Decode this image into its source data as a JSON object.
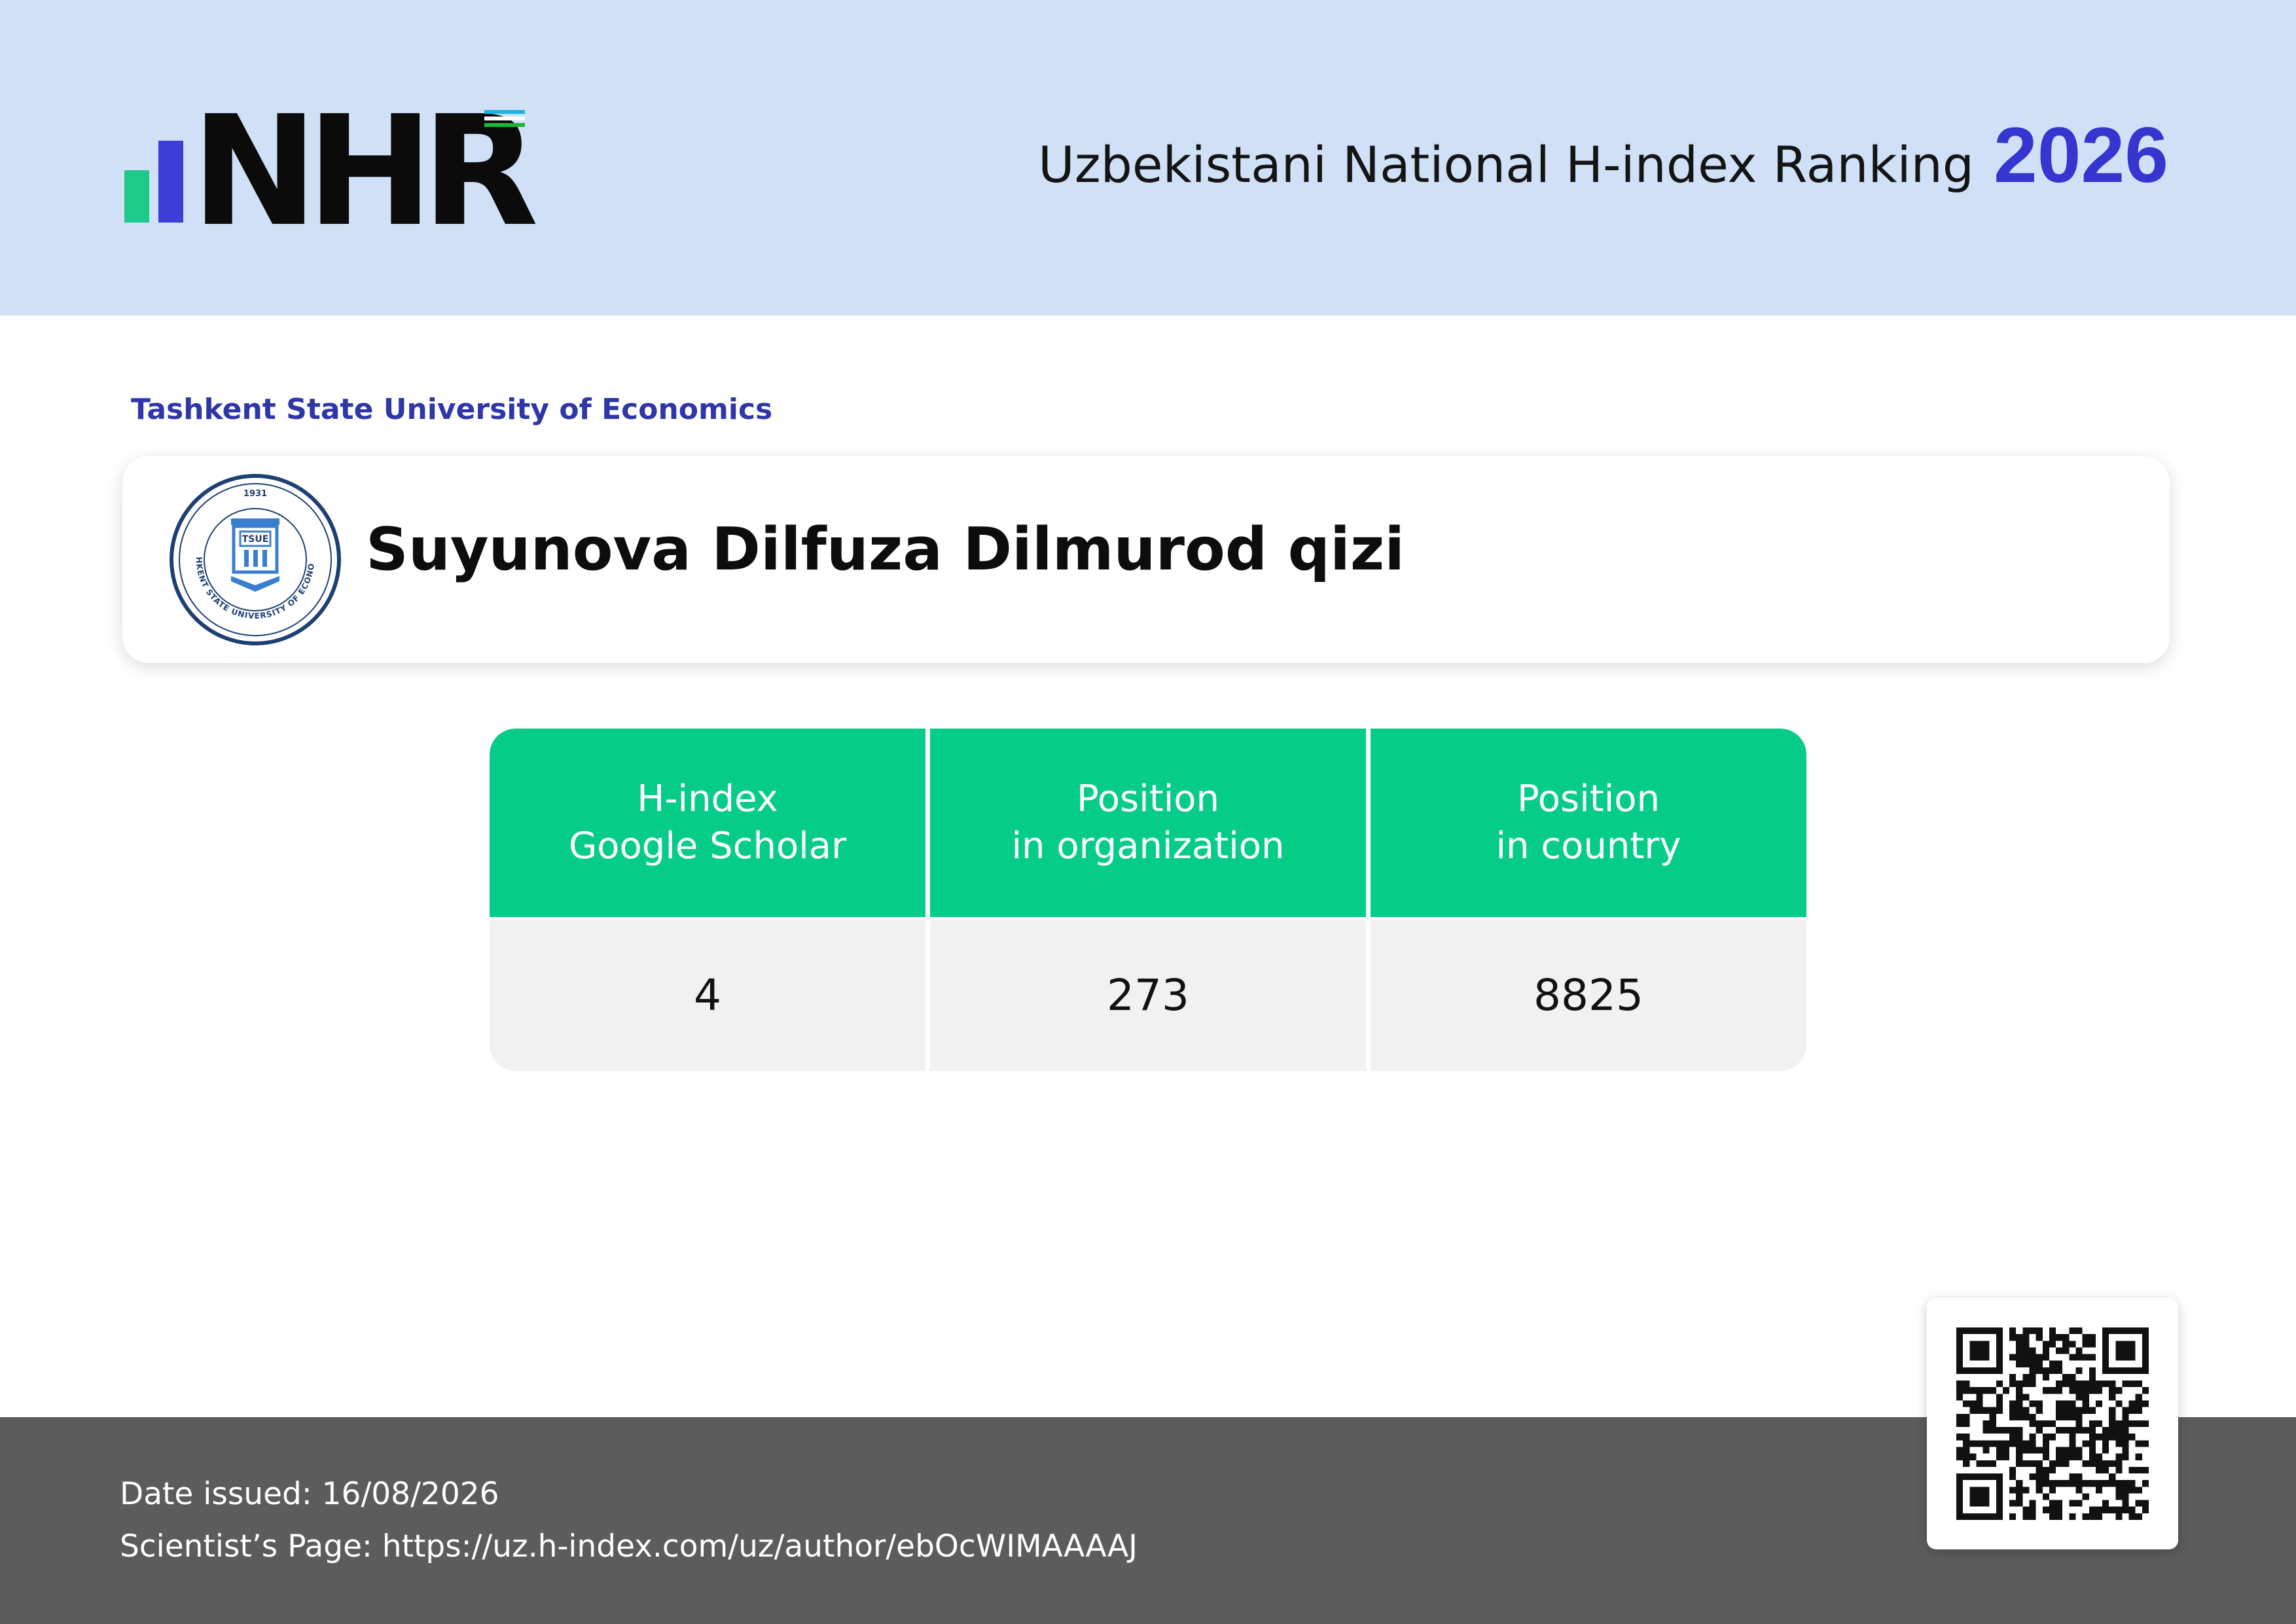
{
  "header": {
    "logo_text": "NHR",
    "title": "Uzbekistani National H-index Ranking",
    "year": "2026",
    "flag_colors": [
      "#1eb4e6",
      "#ffffff",
      "#1eb53a"
    ]
  },
  "organization": {
    "name": "Tashkent State University of Economics",
    "seal": {
      "year": "1931",
      "abbr": "TSUE",
      "ring_text": "TASHKENT STATE UNIVERSITY OF ECONOMICS"
    }
  },
  "scientist": {
    "name": "Suyunova Dilfuza Dilmurod qizi"
  },
  "stats": {
    "columns": [
      {
        "line1": "H-index",
        "line2": "Google Scholar",
        "value": "4"
      },
      {
        "line1": "Position",
        "line2": "in organization",
        "value": "273"
      },
      {
        "line1": "Position",
        "line2": "in country",
        "value": "8825"
      }
    ]
  },
  "footer": {
    "date_label": "Date issued:",
    "date_value": "16/08/2026",
    "page_label": "Scientist’s Page:",
    "page_url": "https://uz.h-index.com/uz/author/ebOcWIMAAAAJ"
  },
  "colors": {
    "header_bg": "#cfe0f7",
    "accent_blue": "#3535cf",
    "accent_green": "#05cc87",
    "footer_bg": "#5c5c5c"
  }
}
